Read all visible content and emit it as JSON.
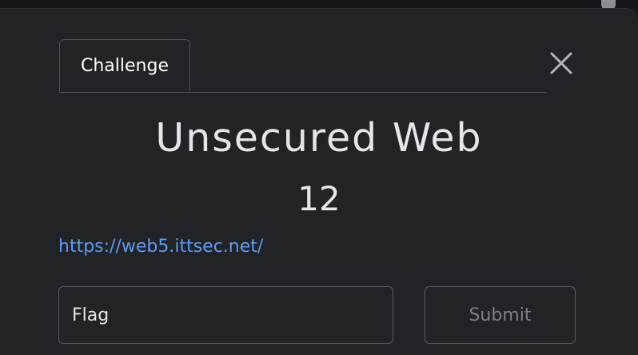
{
  "tabs": [
    {
      "label": "Challenge",
      "active": true
    }
  ],
  "challenge": {
    "name": "Unsecured Web",
    "value": "12",
    "link": "https://web5.ittsec.net/"
  },
  "form": {
    "flag_placeholder": "Flag",
    "submit_label": "Submit"
  },
  "colors": {
    "background": "#212327",
    "text": "#e4e6ea",
    "link": "#5b9cf5",
    "border": "#575a61",
    "muted": "#7d8088"
  },
  "icons": {
    "close": "close-icon"
  }
}
